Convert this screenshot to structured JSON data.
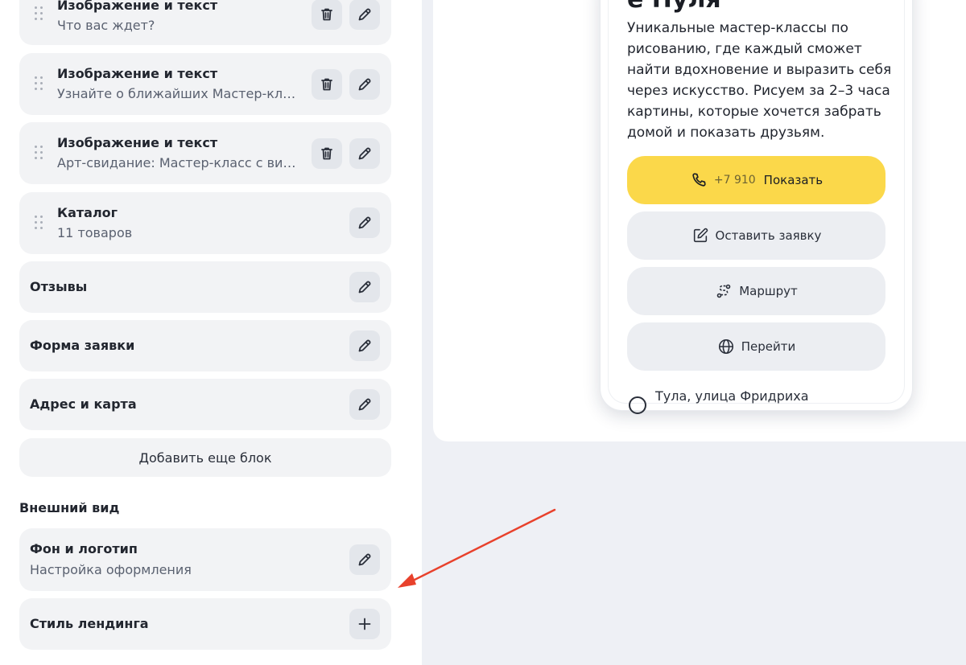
{
  "blocks": [
    {
      "title": "Изображение и текст",
      "subtitle": "Что вас ждет?"
    },
    {
      "title": "Изображение и текст",
      "subtitle": "Узнайте о ближайших Мастер-класс..."
    },
    {
      "title": "Изображение и текст",
      "subtitle": "Арт-свидание: Мастер-класс с вином"
    },
    {
      "title": "Каталог",
      "subtitle": "11 товаров"
    },
    {
      "title": "Отзывы"
    },
    {
      "title": "Форма заявки"
    },
    {
      "title": "Адрес и карта"
    }
  ],
  "add_block_label": "Добавить еще блок",
  "appearance": {
    "heading": "Внешний вид",
    "background": {
      "title": "Фон и логотип",
      "subtitle": "Настройка оформления"
    },
    "style": {
      "title": "Стиль лендинга"
    }
  },
  "preview": {
    "heading_partial": "е Пуля",
    "description": "Уникальные мастер-классы по рисованию, где каждый сможет найти вдохновение и выразить себя через искусство. Рисуем за 2–3 часа картины, которые хочется забрать домой и показать друзьям.",
    "phone_number_partial": "+7 910",
    "show_label": "Показать",
    "request_label": "Оставить заявку",
    "route_label": "Маршрут",
    "go_label": "Перейти",
    "address": "Тула, улица Фридриха"
  },
  "colors": {
    "card_bg": "#f2f3f5",
    "icon_btn_bg": "#e3e6eb",
    "call_button": "#fbd84a",
    "arrow": "#e8412c",
    "right_panel_bg": "#eef0f5"
  },
  "icons": {
    "delete": "trash-icon",
    "edit": "pencil-icon",
    "add": "plus-icon",
    "drag": "drag-handle-icon",
    "phone": "phone-icon",
    "request": "edit-square-icon",
    "route": "route-icon",
    "go": "globe-icon",
    "address": "location-icon"
  }
}
